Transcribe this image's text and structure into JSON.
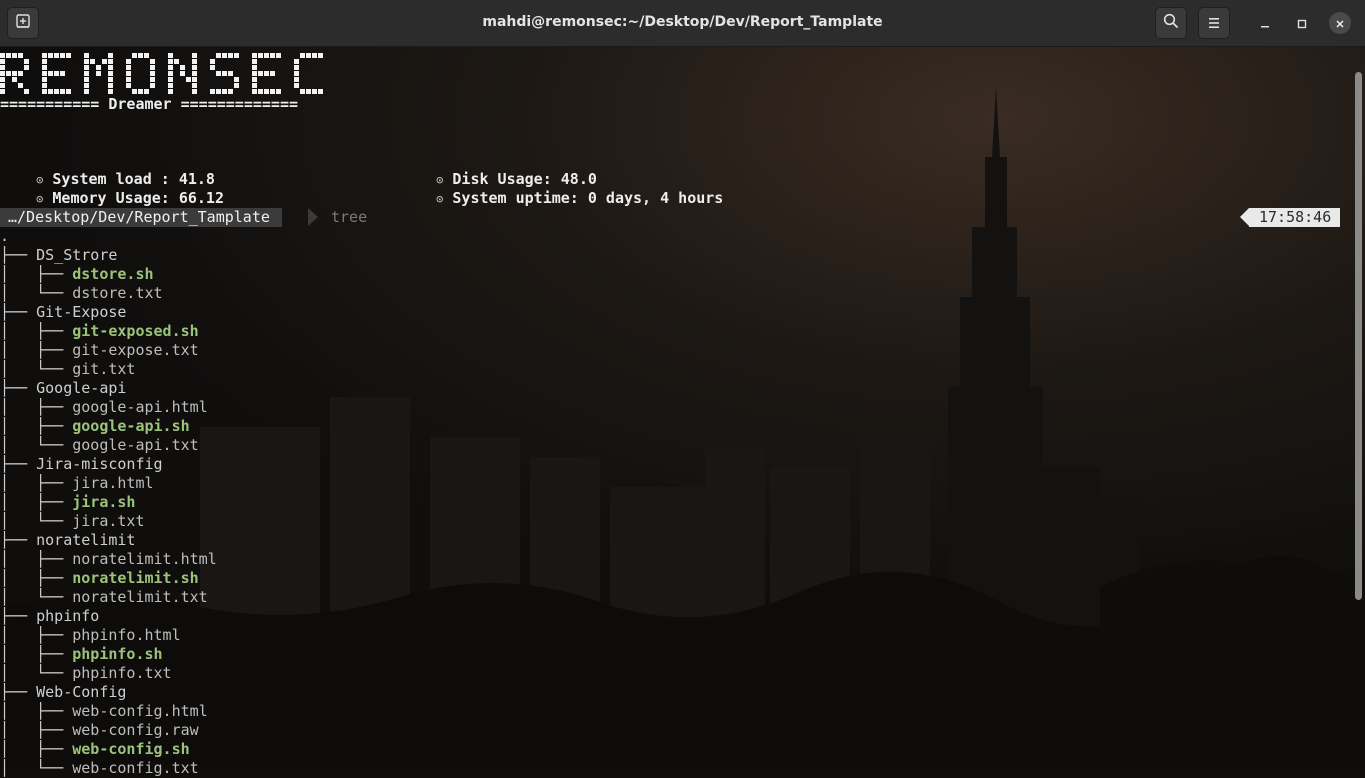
{
  "window": {
    "title": "mahdi@remonsec:~/Desktop/Dev/Report_Tamplate",
    "new_tab_icon": "new-tab-icon",
    "search_icon": "search-icon",
    "menu_icon": "hamburger-menu-icon"
  },
  "banner": {
    "logo_text": "REMONSEC",
    "subtitle": "=========== Dreamer ============="
  },
  "sysinfo": {
    "system_load": "System load : 41.8",
    "memory_usage": "Memory Usage: 66.12",
    "disk_usage": "Disk Usage: 48.0",
    "uptime": "System uptime: 0 days, 4 hours",
    "bullet": "⊙"
  },
  "prompt": {
    "path": "…/Desktop/Dev/Report_Tamplate",
    "command": "tree",
    "time": "17:58:46"
  },
  "tree": {
    "root": ".",
    "rows": [
      {
        "prefix": "├── ",
        "name": "DS_Strore",
        "kind": "dir"
      },
      {
        "prefix": "│   ├── ",
        "name": "dstore.sh",
        "kind": "exec"
      },
      {
        "prefix": "│   └── ",
        "name": "dstore.txt",
        "kind": "file"
      },
      {
        "prefix": "├── ",
        "name": "Git-Expose",
        "kind": "dir"
      },
      {
        "prefix": "│   ├── ",
        "name": "git-exposed.sh",
        "kind": "exec"
      },
      {
        "prefix": "│   ├── ",
        "name": "git-expose.txt",
        "kind": "file"
      },
      {
        "prefix": "│   └── ",
        "name": "git.txt",
        "kind": "file"
      },
      {
        "prefix": "├── ",
        "name": "Google-api",
        "kind": "dir"
      },
      {
        "prefix": "│   ├── ",
        "name": "google-api.html",
        "kind": "file"
      },
      {
        "prefix": "│   ├── ",
        "name": "google-api.sh",
        "kind": "exec"
      },
      {
        "prefix": "│   └── ",
        "name": "google-api.txt",
        "kind": "file"
      },
      {
        "prefix": "├── ",
        "name": "Jira-misconfig",
        "kind": "dir"
      },
      {
        "prefix": "│   ├── ",
        "name": "jira.html",
        "kind": "file"
      },
      {
        "prefix": "│   ├── ",
        "name": "jira.sh",
        "kind": "exec"
      },
      {
        "prefix": "│   └── ",
        "name": "jira.txt",
        "kind": "file"
      },
      {
        "prefix": "├── ",
        "name": "noratelimit",
        "kind": "dir"
      },
      {
        "prefix": "│   ├── ",
        "name": "noratelimit.html",
        "kind": "file"
      },
      {
        "prefix": "│   ├── ",
        "name": "noratelimit.sh",
        "kind": "exec"
      },
      {
        "prefix": "│   └── ",
        "name": "noratelimit.txt",
        "kind": "file"
      },
      {
        "prefix": "├── ",
        "name": "phpinfo",
        "kind": "dir"
      },
      {
        "prefix": "│   ├── ",
        "name": "phpinfo.html",
        "kind": "file"
      },
      {
        "prefix": "│   ├── ",
        "name": "phpinfo.sh",
        "kind": "exec"
      },
      {
        "prefix": "│   └── ",
        "name": "phpinfo.txt",
        "kind": "file"
      },
      {
        "prefix": "├── ",
        "name": "Web-Config",
        "kind": "dir"
      },
      {
        "prefix": "│   ├── ",
        "name": "web-config.html",
        "kind": "file"
      },
      {
        "prefix": "│   ├── ",
        "name": "web-config.raw",
        "kind": "file"
      },
      {
        "prefix": "│   ├── ",
        "name": "web-config.sh",
        "kind": "exec"
      },
      {
        "prefix": "│   └── ",
        "name": "web-config.txt",
        "kind": "file"
      }
    ]
  },
  "colors": {
    "titlebar": "#2c2c2c",
    "terminal_bg": "#0f0e0d",
    "executable": "#9bc37b",
    "prompt_segment": "#3b3b3b",
    "clock_segment": "#e9e9e9"
  }
}
